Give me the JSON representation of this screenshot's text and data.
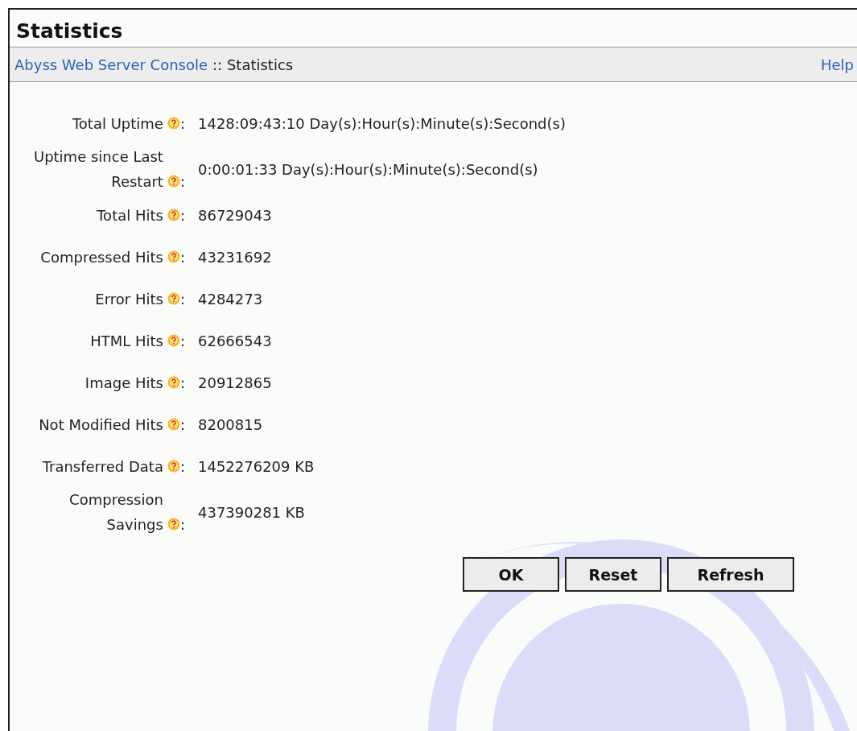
{
  "window": {
    "title": "Statistics"
  },
  "breadcrumb": {
    "link": "Abyss Web Server Console",
    "current": ":: Statistics",
    "help": "Help"
  },
  "stats": [
    {
      "label": "Total Uptime",
      "suffix": ":",
      "value": "1428:09:43:10 Day(s):Hour(s):Minute(s):Second(s)"
    },
    {
      "label": "Uptime since Last Restart",
      "suffix": ":",
      "value": "0:00:01:33 Day(s):Hour(s):Minute(s):Second(s)"
    },
    {
      "label": "Total Hits",
      "suffix": ":",
      "value": "86729043"
    },
    {
      "label": "Compressed Hits",
      "suffix": ":",
      "value": "43231692"
    },
    {
      "label": "Error Hits",
      "suffix": ":",
      "value": "4284273"
    },
    {
      "label": "HTML Hits",
      "suffix": ":",
      "value": "62666543"
    },
    {
      "label": "Image Hits",
      "suffix": ":",
      "value": "20912865"
    },
    {
      "label": "Not Modified Hits",
      "suffix": ":",
      "value": "8200815"
    },
    {
      "label": "Transferred Data",
      "suffix": ":",
      "value": "1452276209 KB"
    },
    {
      "label": "Compression Savings",
      "suffix": ":",
      "value": "437390281 KB"
    }
  ],
  "buttons": [
    "OK",
    "Reset",
    "Refresh"
  ]
}
